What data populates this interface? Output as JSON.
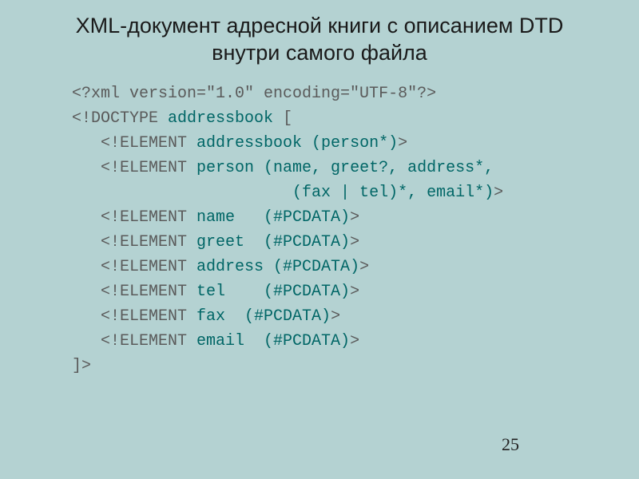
{
  "title": "XML-документ адресной книги с описанием DTD внутри самого файла",
  "code": {
    "l1": "<?xml version=\"1.0\" encoding=\"UTF-8\"?>",
    "l2a": "<!DOCTYPE ",
    "l2b": "addressbook",
    "l2c": " [",
    "l3a": "   <!ELEMENT ",
    "l3b": "addressbook (person*)",
    "l3c": ">",
    "l4a": "   <!ELEMENT ",
    "l4b": "person (name, greet?, address*,",
    "l5a": "                       ",
    "l5b": "(fax | tel)*, email*)",
    "l5c": ">",
    "l6a": "   <!ELEMENT ",
    "l6b": "name   (#PCDATA)",
    "l6c": ">",
    "l7a": "   <!ELEMENT ",
    "l7b": "greet  (#PCDATA)",
    "l7c": ">",
    "l8a": "   <!ELEMENT ",
    "l8b": "address (#PCDATA)",
    "l8c": ">",
    "l9a": "   <!ELEMENT ",
    "l9b": "tel    (#PCDATA)",
    "l9c": ">",
    "l10a": "   <!ELEMENT ",
    "l10b": "fax  (#PCDATA)",
    "l10c": ">",
    "l11a": "   <!ELEMENT ",
    "l11b": "email  (#PCDATA)",
    "l11c": ">",
    "l12": "]>"
  },
  "pageNumber": "25"
}
